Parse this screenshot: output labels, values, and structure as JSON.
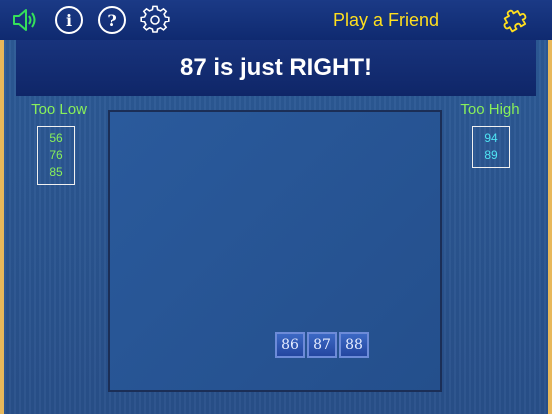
{
  "toolbar": {
    "title": "Play a Friend",
    "info_glyph": "i",
    "help_glyph": "?",
    "icons": [
      "speaker-icon",
      "info-icon",
      "help-icon",
      "gear-icon",
      "puzzle-icon"
    ]
  },
  "banner": {
    "message": "87 is just RIGHT!"
  },
  "too_low": {
    "label": "Too Low",
    "guesses": [
      "56",
      "76",
      "85"
    ]
  },
  "too_high": {
    "label": "Too High",
    "guesses": [
      "94",
      "89"
    ]
  },
  "tiles": [
    "86",
    "87",
    "88"
  ],
  "colors": {
    "title": "#ffdf1e",
    "too_low_text": "#88f05a",
    "too_high_text": "#4fe4f4",
    "frame": "#e8b85a",
    "board": "#2a5a9c"
  }
}
